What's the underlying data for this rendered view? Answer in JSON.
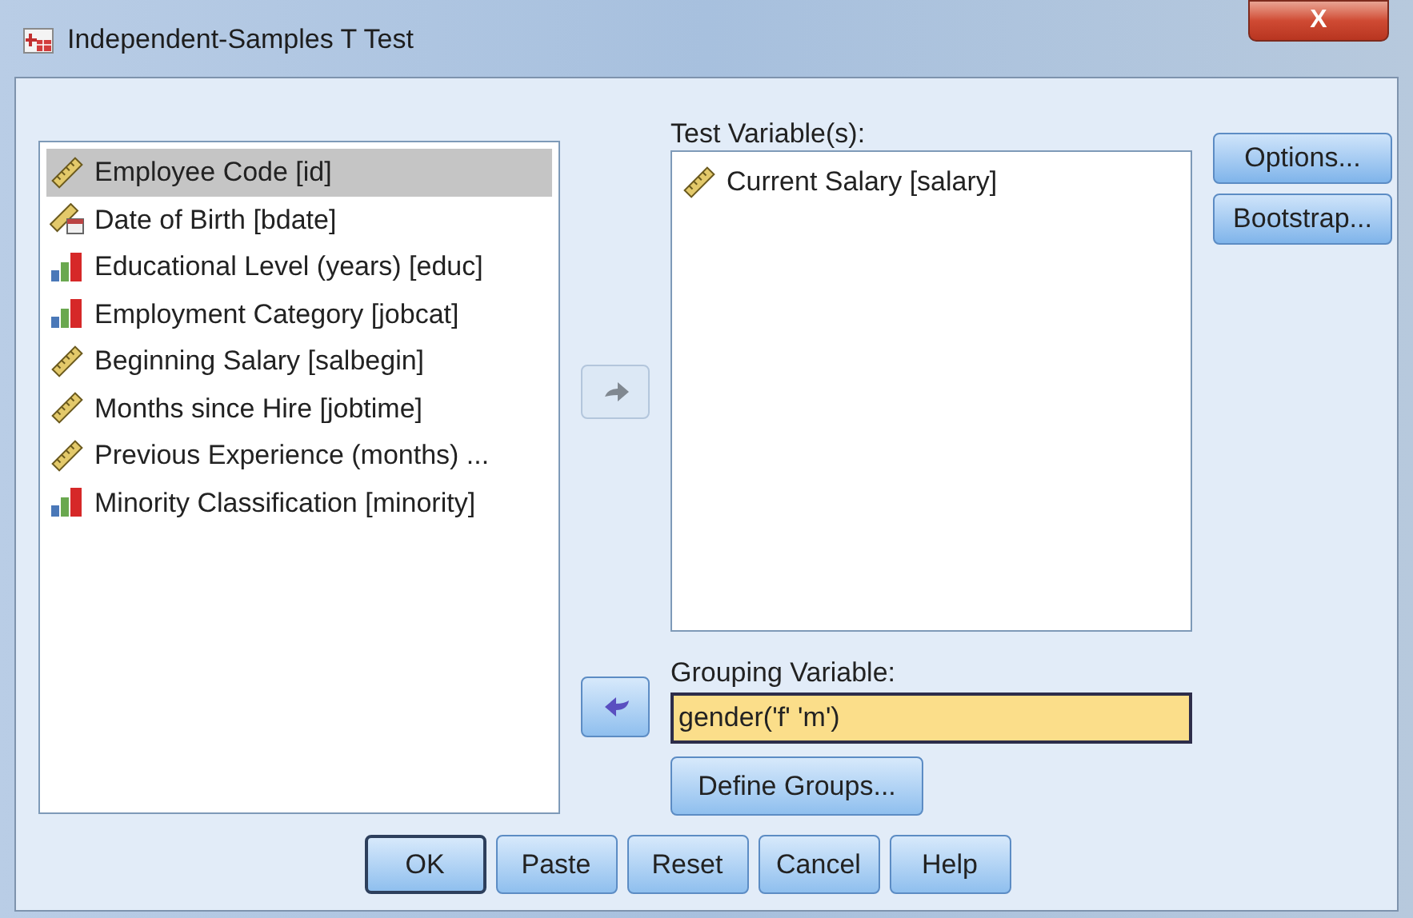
{
  "window": {
    "title": "Independent-Samples T Test",
    "close_symbol": "X"
  },
  "source_variables": [
    {
      "label": "Employee Code [id]",
      "kind": "scale",
      "selected": true
    },
    {
      "label": "Date of Birth [bdate]",
      "kind": "date",
      "selected": false
    },
    {
      "label": "Educational Level (years) [educ]",
      "kind": "ordinal",
      "selected": false
    },
    {
      "label": "Employment Category [jobcat]",
      "kind": "ordinal",
      "selected": false
    },
    {
      "label": "Beginning Salary [salbegin]",
      "kind": "scale",
      "selected": false
    },
    {
      "label": "Months since Hire [jobtime]",
      "kind": "scale",
      "selected": false
    },
    {
      "label": "Previous Experience (months) ...",
      "kind": "scale",
      "selected": false
    },
    {
      "label": "Minority Classification [minority]",
      "kind": "ordinal",
      "selected": false
    }
  ],
  "move_to_test_button": {
    "disabled": true
  },
  "test_variables": {
    "label": "Test Variable(s):",
    "items": [
      {
        "label": "Current Salary [salary]",
        "kind": "scale",
        "selected": false
      }
    ]
  },
  "move_to_grouping_button": {
    "disabled": false
  },
  "grouping_variable": {
    "label": "Grouping Variable:",
    "value": "gender('f' 'm')"
  },
  "define_groups_button": "Define Groups...",
  "side_buttons": [
    "Options...",
    "Bootstrap..."
  ],
  "bottom_buttons": [
    {
      "label": "OK",
      "default": true
    },
    {
      "label": "Paste",
      "default": false
    },
    {
      "label": "Reset",
      "default": false
    },
    {
      "label": "Cancel",
      "default": false
    },
    {
      "label": "Help",
      "default": false
    }
  ]
}
